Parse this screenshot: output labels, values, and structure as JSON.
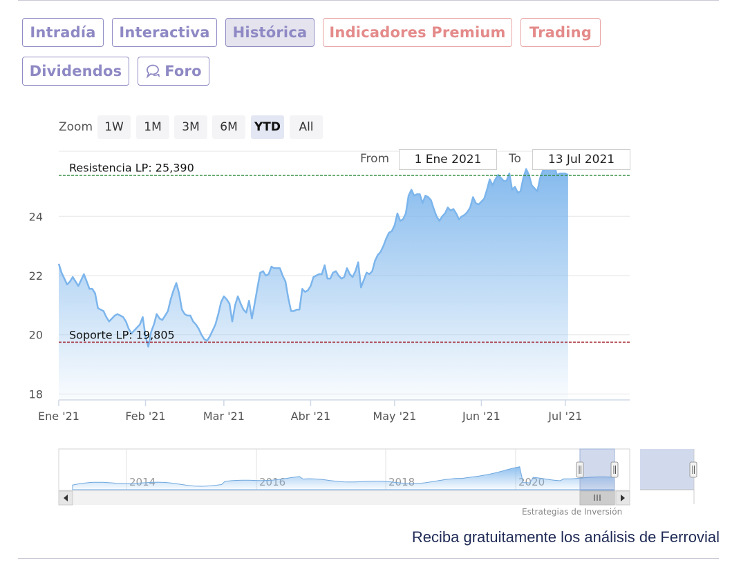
{
  "tabs": [
    {
      "label": "Intradía",
      "style": "purple"
    },
    {
      "label": "Interactiva",
      "style": "purple"
    },
    {
      "label": "Histórica",
      "style": "active"
    },
    {
      "label": "Indicadores Premium",
      "style": "red"
    },
    {
      "label": "Trading",
      "style": "red"
    },
    {
      "label": "Dividendos",
      "style": "purple"
    },
    {
      "label": "Foro",
      "style": "purple",
      "icon": "chat-bubble-icon"
    }
  ],
  "zoom": {
    "label": "Zoom",
    "buttons": [
      "1W",
      "1M",
      "3M",
      "6M",
      "YTD",
      "All"
    ],
    "selected": "YTD"
  },
  "range": {
    "from_label": "From",
    "from_value": "1 Ene 2021",
    "to_label": "To",
    "to_value": "13 Jul 2021"
  },
  "chart_data": {
    "type": "area",
    "y_ticks": [
      "18",
      "20",
      "22",
      "24"
    ],
    "ylim": [
      17.8,
      26.2
    ],
    "x_tick_labels": [
      "Ene '21",
      "Feb '21",
      "Mar '21",
      "Abr '21",
      "May '21",
      "Jun '21",
      "Jul '21"
    ],
    "x_tick_days": [
      0,
      31,
      59,
      90,
      120,
      151,
      181
    ],
    "xlim_days": [
      0,
      204
    ],
    "series": [
      {
        "color": "#7cb5ec",
        "points": [
          [
            0,
            22.4
          ],
          [
            1,
            22.1
          ],
          [
            2,
            21.9
          ],
          [
            3,
            21.7
          ],
          [
            4,
            21.8
          ],
          [
            5,
            21.95
          ],
          [
            6,
            21.8
          ],
          [
            7,
            21.65
          ],
          [
            8,
            21.85
          ],
          [
            9,
            22.05
          ],
          [
            10,
            21.8
          ],
          [
            11,
            21.55
          ],
          [
            12,
            21.55
          ],
          [
            13,
            21.4
          ],
          [
            14,
            20.9
          ],
          [
            15,
            20.85
          ],
          [
            16,
            20.8
          ],
          [
            17,
            20.6
          ],
          [
            18,
            20.45
          ],
          [
            19,
            20.55
          ],
          [
            20,
            20.65
          ],
          [
            21,
            20.7
          ],
          [
            22,
            20.65
          ],
          [
            23,
            20.6
          ],
          [
            24,
            20.45
          ],
          [
            25,
            20.2
          ],
          [
            26,
            20.05
          ],
          [
            27,
            20.15
          ],
          [
            28,
            20.25
          ],
          [
            29,
            20.35
          ],
          [
            30,
            20.6
          ],
          [
            31,
            19.95
          ],
          [
            32,
            19.6
          ],
          [
            33,
            20.1
          ],
          [
            34,
            20.35
          ],
          [
            35,
            20.7
          ],
          [
            36,
            20.55
          ],
          [
            37,
            20.5
          ],
          [
            38,
            20.65
          ],
          [
            39,
            20.8
          ],
          [
            40,
            21.2
          ],
          [
            41,
            21.5
          ],
          [
            42,
            21.75
          ],
          [
            43,
            21.4
          ],
          [
            44,
            20.85
          ],
          [
            45,
            20.7
          ],
          [
            46,
            20.65
          ],
          [
            47,
            20.65
          ],
          [
            48,
            20.45
          ],
          [
            49,
            20.35
          ],
          [
            50,
            20.2
          ],
          [
            51,
            20.0
          ],
          [
            52,
            19.85
          ],
          [
            53,
            19.8
          ],
          [
            54,
            19.95
          ],
          [
            55,
            20.15
          ],
          [
            56,
            20.35
          ],
          [
            57,
            20.7
          ],
          [
            58,
            21.1
          ],
          [
            59,
            21.3
          ],
          [
            60,
            21.2
          ],
          [
            61,
            21.05
          ],
          [
            62,
            20.45
          ],
          [
            63,
            21.0
          ],
          [
            64,
            21.3
          ],
          [
            65,
            21.05
          ],
          [
            66,
            20.85
          ],
          [
            67,
            20.75
          ],
          [
            68,
            21.15
          ],
          [
            69,
            20.55
          ],
          [
            70,
            21.05
          ],
          [
            71,
            21.6
          ],
          [
            72,
            22.1
          ],
          [
            73,
            22.15
          ],
          [
            74,
            22.0
          ],
          [
            75,
            22.05
          ],
          [
            76,
            22.3
          ],
          [
            77,
            22.25
          ],
          [
            78,
            22.25
          ],
          [
            79,
            22.25
          ],
          [
            80,
            22.0
          ],
          [
            81,
            21.8
          ],
          [
            82,
            21.25
          ],
          [
            83,
            20.8
          ],
          [
            84,
            20.8
          ],
          [
            85,
            20.85
          ],
          [
            86,
            20.85
          ],
          [
            87,
            21.55
          ],
          [
            88,
            21.45
          ],
          [
            89,
            21.5
          ],
          [
            90,
            21.65
          ],
          [
            91,
            21.95
          ],
          [
            92,
            22.0
          ],
          [
            93,
            22.05
          ],
          [
            94,
            22.05
          ],
          [
            95,
            22.35
          ],
          [
            96,
            21.9
          ],
          [
            97,
            21.9
          ],
          [
            98,
            22.1
          ],
          [
            99,
            22.15
          ],
          [
            100,
            22.0
          ],
          [
            101,
            21.9
          ],
          [
            102,
            21.95
          ],
          [
            103,
            22.25
          ],
          [
            104,
            22.05
          ],
          [
            105,
            21.95
          ],
          [
            106,
            22.15
          ],
          [
            107,
            22.45
          ],
          [
            108,
            21.6
          ],
          [
            109,
            21.85
          ],
          [
            110,
            22.1
          ],
          [
            111,
            22.05
          ],
          [
            112,
            22.15
          ],
          [
            113,
            22.5
          ],
          [
            114,
            22.7
          ],
          [
            115,
            22.8
          ],
          [
            116,
            23.0
          ],
          [
            117,
            23.25
          ],
          [
            118,
            23.45
          ],
          [
            119,
            23.5
          ],
          [
            120,
            23.7
          ],
          [
            121,
            24.1
          ],
          [
            122,
            23.85
          ],
          [
            123,
            23.9
          ],
          [
            124,
            24.1
          ],
          [
            125,
            24.7
          ],
          [
            126,
            24.9
          ],
          [
            127,
            24.7
          ],
          [
            128,
            24.75
          ],
          [
            129,
            24.75
          ],
          [
            130,
            24.45
          ],
          [
            131,
            24.7
          ],
          [
            132,
            24.65
          ],
          [
            133,
            24.55
          ],
          [
            134,
            24.25
          ],
          [
            135,
            24.0
          ],
          [
            136,
            23.85
          ],
          [
            137,
            24.0
          ],
          [
            138,
            24.1
          ],
          [
            139,
            24.3
          ],
          [
            140,
            24.2
          ],
          [
            141,
            24.25
          ],
          [
            142,
            24.1
          ],
          [
            143,
            23.9
          ],
          [
            144,
            24.0
          ],
          [
            145,
            24.05
          ],
          [
            146,
            24.15
          ],
          [
            147,
            24.3
          ],
          [
            148,
            24.65
          ],
          [
            149,
            24.45
          ],
          [
            150,
            24.4
          ],
          [
            151,
            24.5
          ],
          [
            152,
            24.6
          ],
          [
            153,
            24.9
          ],
          [
            154,
            25.25
          ],
          [
            155,
            25.05
          ],
          [
            156,
            25.25
          ],
          [
            157,
            25.4
          ],
          [
            158,
            25.3
          ],
          [
            159,
            25.2
          ],
          [
            160,
            25.2
          ],
          [
            161,
            25.45
          ],
          [
            162,
            24.9
          ],
          [
            163,
            25.0
          ],
          [
            164,
            24.8
          ],
          [
            165,
            24.85
          ],
          [
            166,
            25.3
          ],
          [
            167,
            25.6
          ],
          [
            168,
            25.4
          ],
          [
            169,
            25.05
          ],
          [
            170,
            24.95
          ],
          [
            171,
            24.85
          ],
          [
            172,
            25.3
          ],
          [
            173,
            25.55
          ],
          [
            174,
            25.6
          ],
          [
            175,
            25.6
          ],
          [
            176,
            25.6
          ],
          [
            177,
            25.75
          ],
          [
            178,
            25.4
          ],
          [
            179,
            25.45
          ],
          [
            180,
            25.45
          ],
          [
            181,
            25.45
          ],
          [
            182,
            25.4
          ]
        ]
      }
    ],
    "plot_lines": [
      {
        "label": "Resistencia LP: 25,390",
        "value": 25.39,
        "color": "#2e8b3a"
      },
      {
        "label": "Soporte LP: 19,805",
        "value": 19.75,
        "color": "#a0202a"
      }
    ],
    "navigator": {
      "year_labels": [
        "2014",
        "2016",
        "2018",
        "2020"
      ]
    },
    "credits": "Estrategias de Inversión"
  },
  "footer_text": "Reciba gratuitamente los análisis de Ferrovial"
}
